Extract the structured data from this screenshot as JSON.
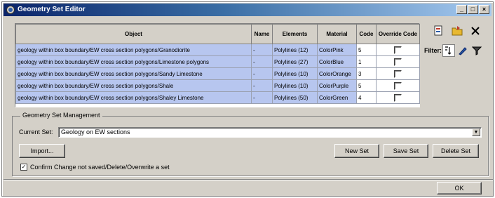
{
  "window": {
    "title": "Geometry Set Editor",
    "controls": [
      "_",
      "□",
      "×"
    ]
  },
  "grid": {
    "columns": [
      "Object",
      "Name",
      "Elements",
      "Material",
      "Code",
      "Override Code"
    ],
    "rows": [
      {
        "object": "geology within box boundary/EW cross section polygons/Granodiorite",
        "name": "-",
        "elements": "Polylines (12)",
        "material": "ColorPink",
        "code": "5",
        "override": false
      },
      {
        "object": "geology within box boundary/EW cross section polygons/Limestone polygons",
        "name": "-",
        "elements": "Polylines (27)",
        "material": "ColorBlue",
        "code": "1",
        "override": false
      },
      {
        "object": "geology within box boundary/EW cross section polygons/Sandy Limestone",
        "name": "-",
        "elements": "Polylines (10)",
        "material": "ColorOrange",
        "code": "3",
        "override": false
      },
      {
        "object": "geology within box boundary/EW cross section polygons/Shale",
        "name": "-",
        "elements": "Polylines (10)",
        "material": "ColorPurple",
        "code": "5",
        "override": false
      },
      {
        "object": "geology within box boundary/EW cross section polygons/Shaley Limestone",
        "name": "-",
        "elements": "Polylines (50)",
        "material": "ColorGreen",
        "code": "4",
        "override": false
      }
    ]
  },
  "side": {
    "icons": [
      "report-icon",
      "folder-icon",
      "close-icon"
    ],
    "filter_label": "Filter:",
    "filter_icons": [
      "sort-icon",
      "pen-icon",
      "funnel-icon"
    ]
  },
  "management": {
    "group_title": "Geometry Set Management",
    "current_set_label": "Current Set:",
    "current_set_value": "Geology on EW sections",
    "import_label": "Import...",
    "new_set_label": "New Set",
    "save_set_label": "Save Set",
    "delete_set_label": "Delete Set",
    "confirm_label": "Confirm Change not saved/Delete/Overwrite a set",
    "confirm_checked": true
  },
  "footer": {
    "ok_label": "OK"
  }
}
